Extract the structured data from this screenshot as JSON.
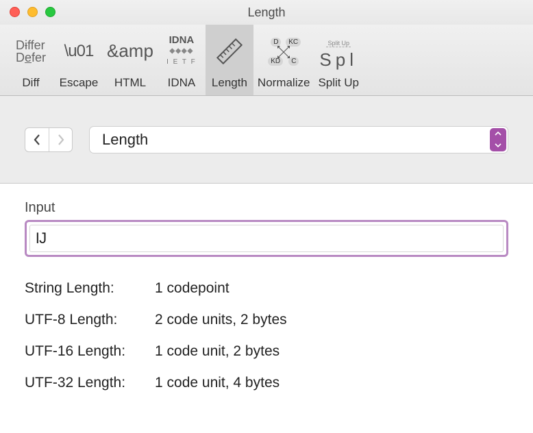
{
  "window": {
    "title": "Length"
  },
  "toolbar": {
    "items": [
      {
        "label": "Diff"
      },
      {
        "label": "Escape",
        "glyph": "\\u01"
      },
      {
        "label": "HTML",
        "glyph": "&amp"
      },
      {
        "label": "IDNA",
        "glyph_top": "IDNA",
        "glyph_mid": "◆◆◆◆",
        "glyph_bot": "I E T F"
      },
      {
        "label": "Length"
      },
      {
        "label": "Normalize",
        "badges": [
          "D",
          "KC",
          "KD",
          "C"
        ]
      },
      {
        "label": "Split Up",
        "glyph_top": "Split Up",
        "glyph_main": "Spl"
      }
    ]
  },
  "subbar": {
    "dropdown_value": "Length"
  },
  "input": {
    "label": "Input",
    "value": "Ĳ"
  },
  "results": [
    {
      "label": "String Length:",
      "value": "1 codepoint"
    },
    {
      "label": "UTF-8 Length:",
      "value": "2 code units, 2 bytes"
    },
    {
      "label": "UTF-16 Length:",
      "value": "1 code unit, 2 bytes"
    },
    {
      "label": "UTF-32 Length:",
      "value": "1 code unit, 4 bytes"
    }
  ]
}
